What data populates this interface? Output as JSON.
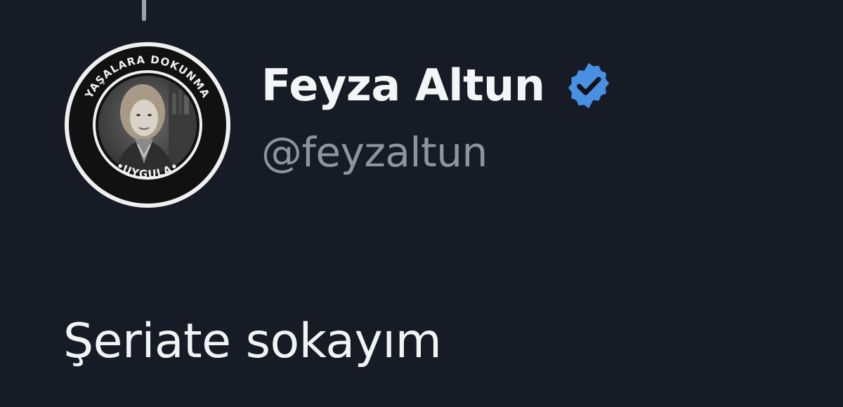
{
  "tweet": {
    "author": {
      "display_name": "Feyza Altun",
      "handle": "@feyzaltun",
      "verified": true,
      "verified_icon": "verified-badge-icon",
      "avatar": {
        "ring_text_top": "YAŞALARA DOKUNMA",
        "ring_text_bottom": "•UYGULA•"
      }
    },
    "text": "Şeriate sokayım"
  },
  "colors": {
    "background": "#161b26",
    "verified_badge": "#4a90e2",
    "handle": "#8f949c",
    "text": "#f2f3f5"
  }
}
